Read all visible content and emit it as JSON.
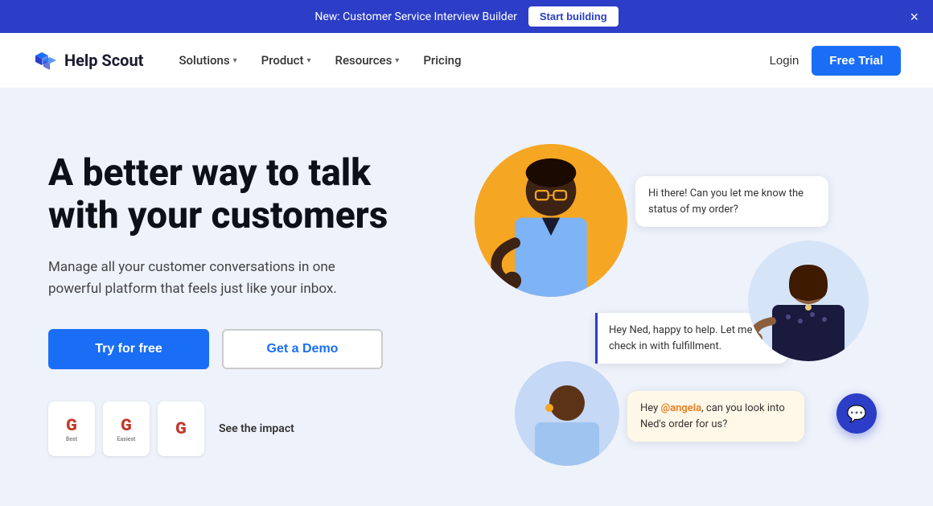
{
  "announcement": {
    "text": "New: Customer Service Interview Builder",
    "cta_label": "Start building",
    "close_label": "×"
  },
  "nav": {
    "logo_text": "Help Scout",
    "links": [
      {
        "label": "Solutions",
        "has_dropdown": true
      },
      {
        "label": "Product",
        "has_dropdown": true
      },
      {
        "label": "Resources",
        "has_dropdown": true
      },
      {
        "label": "Pricing",
        "has_dropdown": false
      }
    ],
    "login_label": "Login",
    "free_trial_label": "Free Trial"
  },
  "hero": {
    "title": "A better way to talk with your customers",
    "subtitle": "Manage all your customer conversations in one powerful platform that feels just like your inbox.",
    "try_free_label": "Try for free",
    "get_demo_label": "Get a Demo",
    "badges": [
      {
        "g_letter": "G",
        "label": "Best"
      },
      {
        "g_letter": "G",
        "label": "Easiest"
      },
      {
        "g_letter": "G",
        "label": ""
      }
    ],
    "see_impact_label": "See the impact"
  },
  "illustration": {
    "chat_bubble_1": "Hi there! Can you let me know the status of my order?",
    "chat_bubble_2": "Hey Ned, happy to help. Let me check in with fulfillment.",
    "chat_bubble_3_prefix": "Hey ",
    "chat_bubble_3_mention": "@angela",
    "chat_bubble_3_suffix": ", can you look into Ned's order for us?",
    "chat_icon": "💬"
  },
  "colors": {
    "brand_blue": "#1a6ef5",
    "nav_bg": "#2c3dc7",
    "hero_bg": "#eef2fb",
    "orange_circle": "#f5a623",
    "light_blue_circle": "#c5d8f5"
  }
}
